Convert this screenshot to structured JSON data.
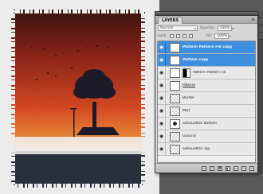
{
  "panel": {
    "tab": "LAYERS",
    "menu_icon": "panel-menu-icon",
    "blend_mode": "Normal",
    "opacity_label": "Opacity:",
    "opacity_value": "100%",
    "lock_label": "Lock:",
    "fill_label": "Fill:",
    "fill_value": "100%"
  },
  "layers": [
    {
      "name": "Pattern Pattern Fill copy",
      "thumb": "white",
      "selected": true,
      "mask": false
    },
    {
      "name": "Pattern copy",
      "thumb": "white",
      "selected": true,
      "mask": false
    },
    {
      "name": "Pattern Pattern Fill",
      "thumb": "white",
      "selected": false,
      "mask": true
    },
    {
      "name": "Pattern",
      "thumb": "white",
      "selected": false,
      "mask": false
    },
    {
      "name": "Border",
      "thumb": "checker",
      "selected": false,
      "mask": false
    },
    {
      "name": "Mist",
      "thumb": "checker",
      "selected": false,
      "mask": false
    },
    {
      "name": "Silhouettes Bottom",
      "thumb": "tree",
      "selected": false,
      "mask": false
    },
    {
      "name": "Ground",
      "thumb": "checker",
      "selected": false,
      "mask": false
    },
    {
      "name": "Silhouettes Top",
      "thumb": "checker",
      "selected": false,
      "mask": false
    }
  ],
  "footer_icons": [
    "link-icon",
    "fx-icon",
    "mask-icon",
    "adjustment-icon",
    "folder-icon",
    "new-layer-icon",
    "trash-icon"
  ]
}
